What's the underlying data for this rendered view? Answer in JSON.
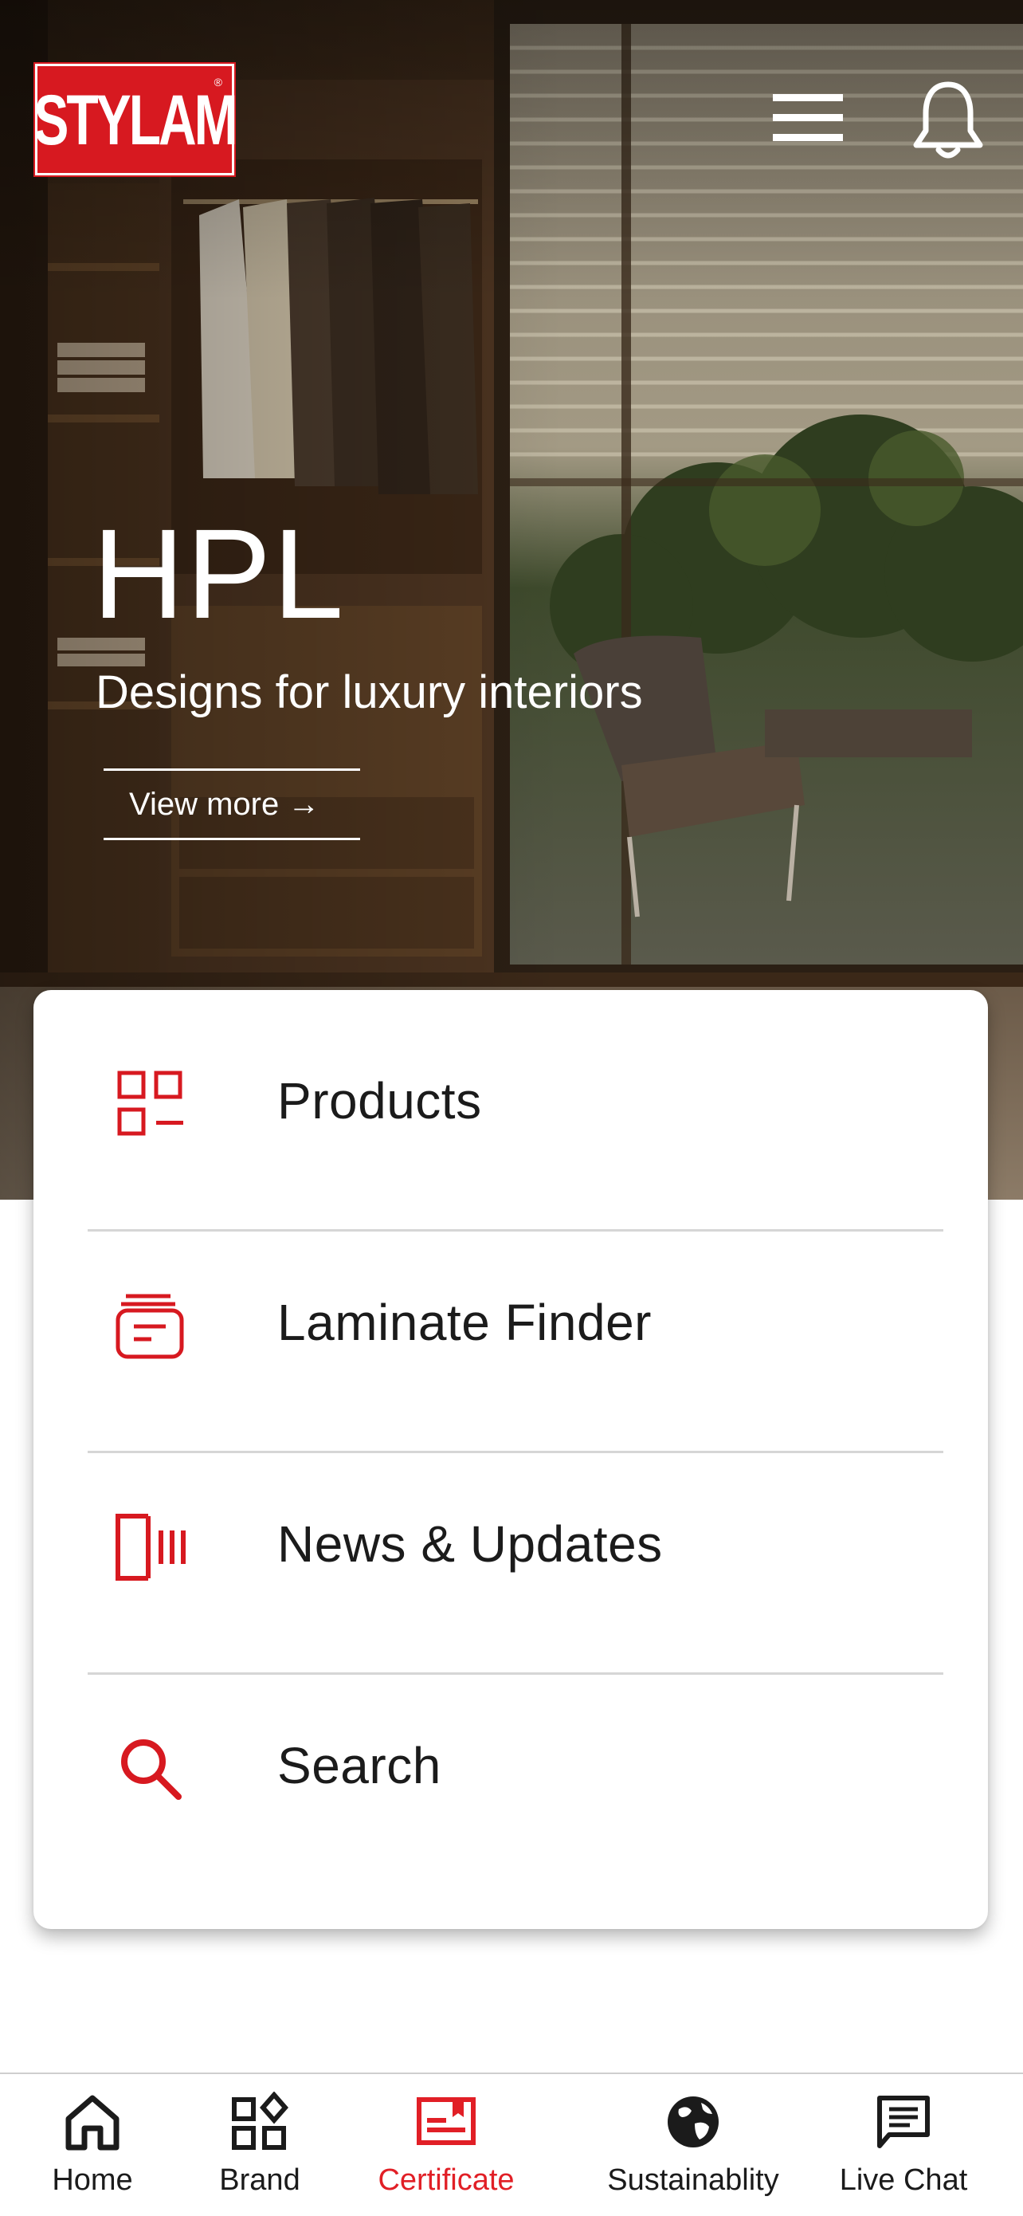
{
  "app": {
    "brand": "STYLAM",
    "accent_color": "#e11f26"
  },
  "header": {
    "menu_icon": "hamburger-menu-icon",
    "notification_icon": "bell-icon"
  },
  "hero": {
    "title": "HPL",
    "subtitle": "Designs for luxury interiors",
    "cta_label": "View more →"
  },
  "menu": {
    "items": [
      {
        "label": "Products",
        "icon": "grid-list-icon"
      },
      {
        "label": "Laminate Finder",
        "icon": "layers-document-icon"
      },
      {
        "label": "News & Updates",
        "icon": "news-bars-icon"
      },
      {
        "label": "Search",
        "icon": "search-icon"
      }
    ]
  },
  "bottom_nav": {
    "active": "Certificate",
    "items": [
      {
        "label": "Home",
        "icon": "home-icon"
      },
      {
        "label": "Brand",
        "icon": "brand-grid-icon"
      },
      {
        "label": "Certificate",
        "icon": "certificate-icon"
      },
      {
        "label": "Sustainablity",
        "icon": "globe-icon"
      },
      {
        "label": "Live Chat",
        "icon": "chat-bubble-icon"
      }
    ]
  }
}
